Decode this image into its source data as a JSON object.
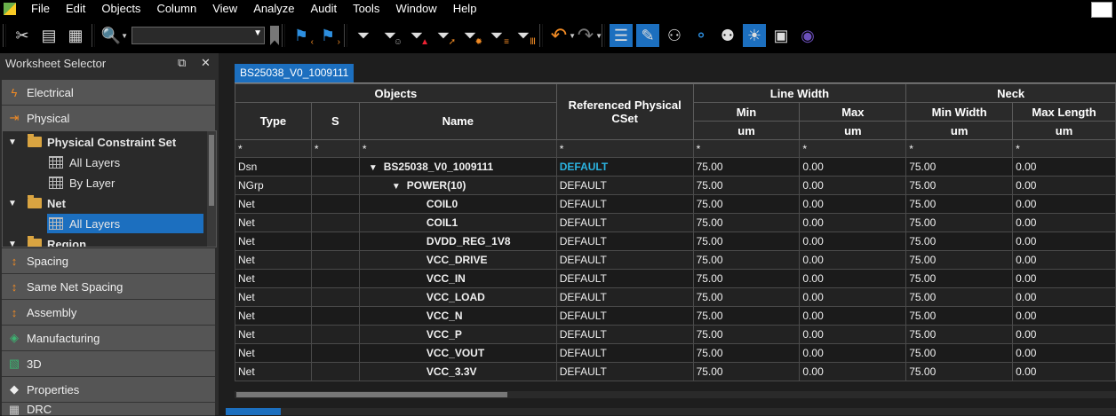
{
  "menu": [
    "File",
    "Edit",
    "Objects",
    "Column",
    "View",
    "Analyze",
    "Audit",
    "Tools",
    "Window",
    "Help"
  ],
  "toolbar": {
    "object_combo_value": "",
    "icons": [
      "scissors-icon",
      "copy-icon",
      "paste-icon",
      "find-icon",
      "bookmark-icon",
      "go-back-bookmark-icon",
      "go-forward-bookmark-icon",
      "filter-icon",
      "filter-smiley-icon",
      "filter-warning-icon",
      "filter-arrow-icon",
      "filter-gear-icon",
      "filter-list-icon",
      "filter-columns-icon",
      "undo-icon",
      "redo-icon",
      "worksheet-mode-icon",
      "tag-icon",
      "toggle-icon",
      "schedule-icon",
      "toggle-off-icon",
      "settings-sun-icon",
      "report-icon",
      "search-object-icon"
    ]
  },
  "worksheet_selector": {
    "title": "Worksheet Selector",
    "categories_top": [
      {
        "label": "Electrical",
        "icon": "lightning-icon"
      },
      {
        "label": "Physical",
        "icon": "physical-icon"
      }
    ],
    "tree": [
      {
        "label": "Physical Constraint Set",
        "kind": "folder",
        "level": 0,
        "bold": true
      },
      {
        "label": "All Layers",
        "kind": "sheet",
        "level": 1
      },
      {
        "label": "By Layer",
        "kind": "sheet",
        "level": 1
      },
      {
        "label": "Net",
        "kind": "folder",
        "level": 0,
        "bold": true
      },
      {
        "label": "All Layers",
        "kind": "sheet",
        "level": 1,
        "selected": true
      },
      {
        "label": "Region",
        "kind": "folder",
        "level": 0,
        "bold": true
      }
    ],
    "categories_bottom": [
      {
        "label": "Spacing",
        "icon": "spacing-icon"
      },
      {
        "label": "Same Net Spacing",
        "icon": "same-net-spacing-icon"
      },
      {
        "label": "Assembly",
        "icon": "assembly-icon"
      },
      {
        "label": "Manufacturing",
        "icon": "manufacturing-icon"
      },
      {
        "label": "3D",
        "icon": "3d-icon"
      },
      {
        "label": "Properties",
        "icon": "tag-icon"
      },
      {
        "label": "DRC",
        "icon": "drc-icon"
      }
    ]
  },
  "worksheet": {
    "tab_label": "BS25038_V0_1009111",
    "headers": {
      "objects": "Objects",
      "type": "Type",
      "s": "S",
      "name": "Name",
      "ref_cset": "Referenced Physical CSet",
      "line_width": "Line Width",
      "min": "Min",
      "max": "Max",
      "neck": "Neck",
      "min_width": "Min Width",
      "max_length": "Max Length",
      "unit": "um"
    },
    "filter": "*",
    "rows": [
      {
        "type": "Dsn",
        "name": "BS25038_V0_1009111",
        "indent": 0,
        "expander": "▼",
        "cset": "DEFAULT",
        "cset_link": true,
        "lw_min": "75.00",
        "lw_max": "0.00",
        "neck_min": "75.00",
        "neck_len": "0.00"
      },
      {
        "type": "NGrp",
        "name": "POWER(10)",
        "indent": 1,
        "expander": "▼",
        "cset": "DEFAULT",
        "lw_min": "75.00",
        "lw_max": "0.00",
        "neck_min": "75.00",
        "neck_len": "0.00"
      },
      {
        "type": "Net",
        "name": "COIL0",
        "indent": 2,
        "cset": "DEFAULT",
        "lw_min": "75.00",
        "lw_max": "0.00",
        "neck_min": "75.00",
        "neck_len": "0.00"
      },
      {
        "type": "Net",
        "name": "COIL1",
        "indent": 2,
        "cset": "DEFAULT",
        "lw_min": "75.00",
        "lw_max": "0.00",
        "neck_min": "75.00",
        "neck_len": "0.00"
      },
      {
        "type": "Net",
        "name": "DVDD_REG_1V8",
        "indent": 2,
        "cset": "DEFAULT",
        "lw_min": "75.00",
        "lw_max": "0.00",
        "neck_min": "75.00",
        "neck_len": "0.00"
      },
      {
        "type": "Net",
        "name": "VCC_DRIVE",
        "indent": 2,
        "cset": "DEFAULT",
        "lw_min": "75.00",
        "lw_max": "0.00",
        "neck_min": "75.00",
        "neck_len": "0.00"
      },
      {
        "type": "Net",
        "name": "VCC_IN",
        "indent": 2,
        "cset": "DEFAULT",
        "lw_min": "75.00",
        "lw_max": "0.00",
        "neck_min": "75.00",
        "neck_len": "0.00"
      },
      {
        "type": "Net",
        "name": "VCC_LOAD",
        "indent": 2,
        "cset": "DEFAULT",
        "lw_min": "75.00",
        "lw_max": "0.00",
        "neck_min": "75.00",
        "neck_len": "0.00"
      },
      {
        "type": "Net",
        "name": "VCC_N",
        "indent": 2,
        "cset": "DEFAULT",
        "lw_min": "75.00",
        "lw_max": "0.00",
        "neck_min": "75.00",
        "neck_len": "0.00"
      },
      {
        "type": "Net",
        "name": "VCC_P",
        "indent": 2,
        "cset": "DEFAULT",
        "lw_min": "75.00",
        "lw_max": "0.00",
        "neck_min": "75.00",
        "neck_len": "0.00"
      },
      {
        "type": "Net",
        "name": "VCC_VOUT",
        "indent": 2,
        "cset": "DEFAULT",
        "lw_min": "75.00",
        "lw_max": "0.00",
        "neck_min": "75.00",
        "neck_len": "0.00"
      },
      {
        "type": "Net",
        "name": "VCC_3.3V",
        "indent": 2,
        "cset": "DEFAULT",
        "lw_min": "75.00",
        "lw_max": "0.00",
        "neck_min": "75.00",
        "neck_len": "0.00"
      }
    ]
  },
  "colors": {
    "accent": "#1c6fbf",
    "link": "#2bb3e0"
  }
}
